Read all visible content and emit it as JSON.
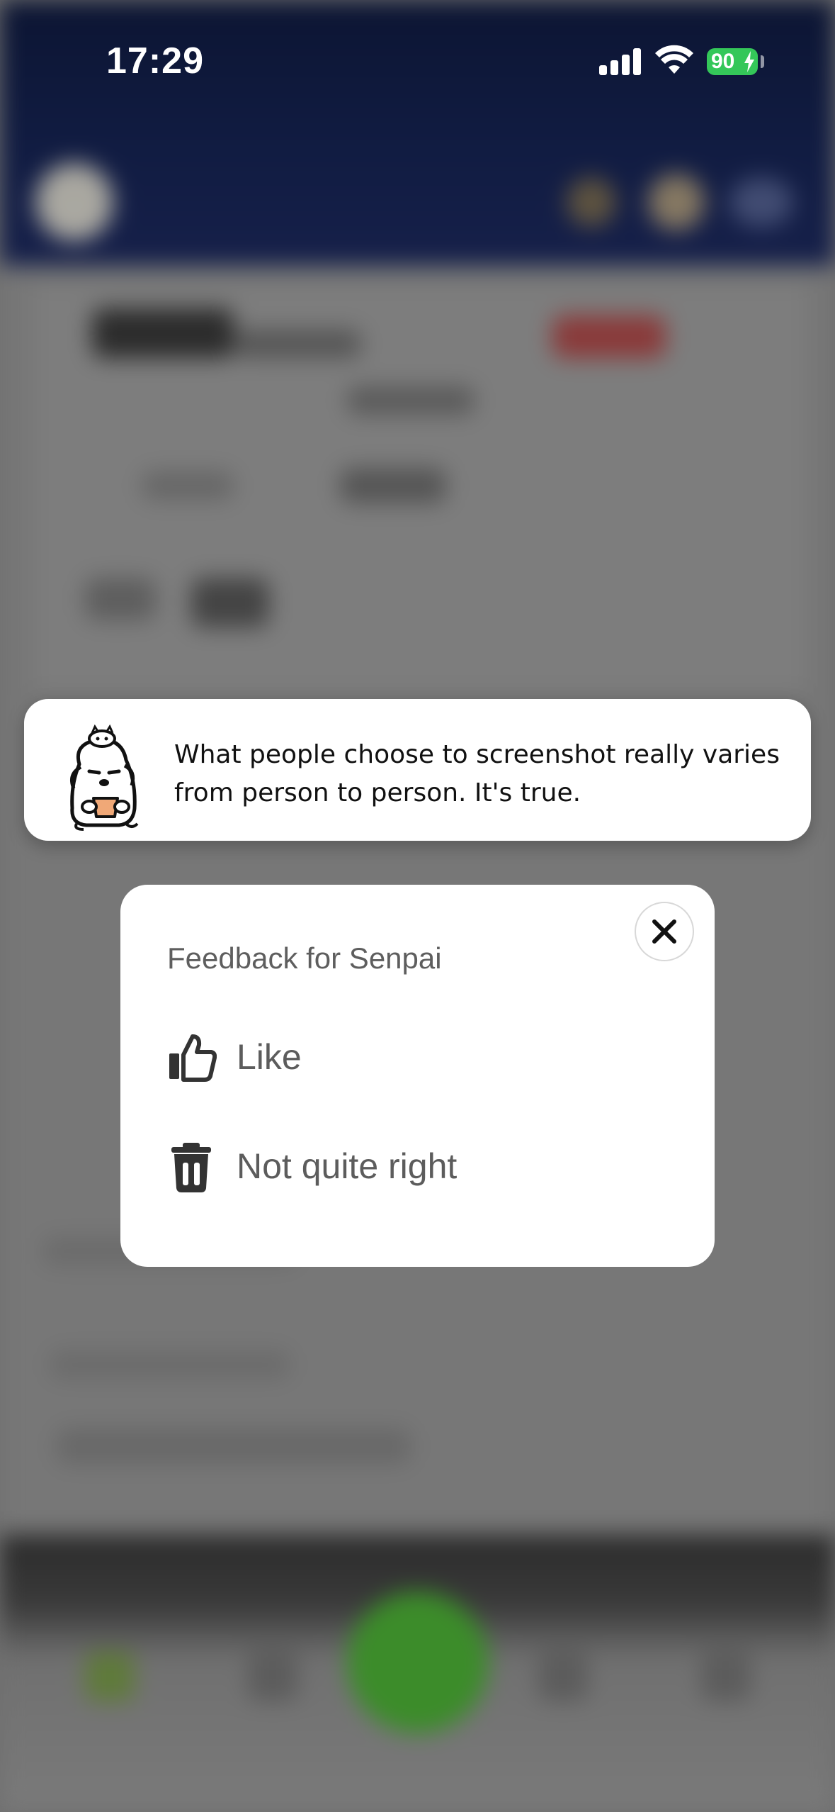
{
  "status_bar": {
    "time": "17:29",
    "battery_percent": "90"
  },
  "toast": {
    "message": "What people choose to screenshot really varies from person to person. It's true.",
    "mascot_icon": "dog-mascot-with-cup-icon"
  },
  "feedback": {
    "title": "Feedback for Senpai",
    "close_icon": "close-icon",
    "options": [
      {
        "label": "Like",
        "icon": "thumbs-up-icon"
      },
      {
        "label": "Not quite right",
        "icon": "trash-icon"
      }
    ]
  },
  "colors": {
    "header_navy": "#111c42",
    "overlay_gray": "#777777",
    "battery_green": "#34c759",
    "fab_green": "#3c8c2a",
    "sheet_bg": "#ffffff"
  }
}
